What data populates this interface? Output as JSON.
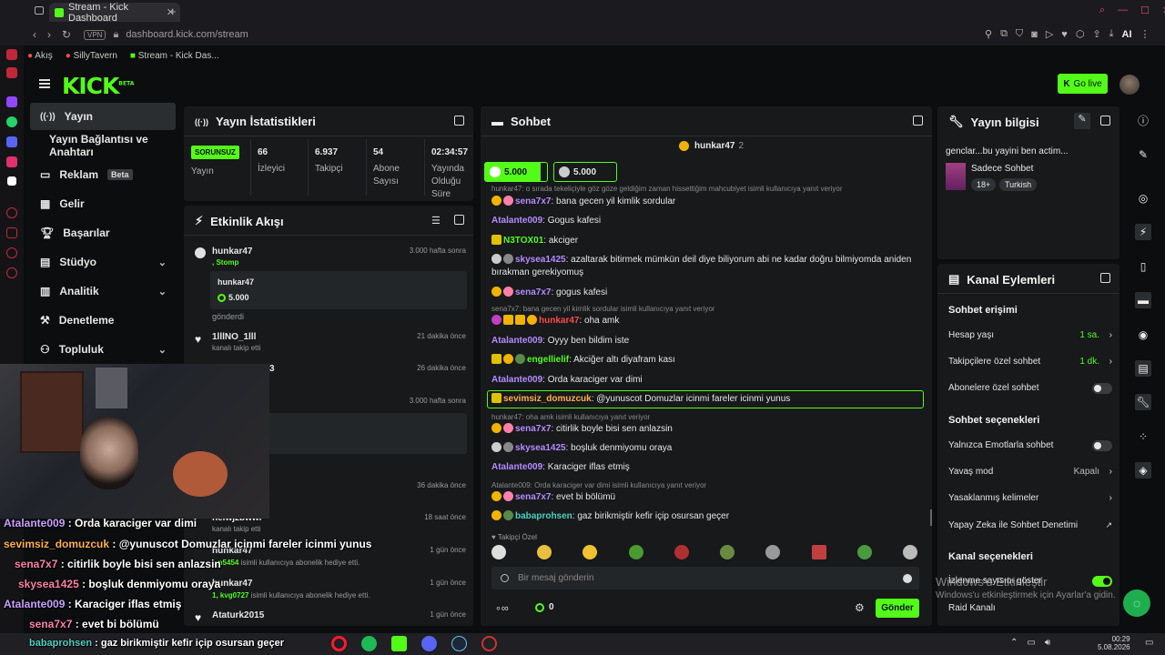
{
  "browser": {
    "tab_title": "Stream - Kick Dashboard",
    "url": "dashboard.kick.com/stream",
    "vpn": "VPN",
    "ai": "AI",
    "bookmarks": [
      "Akış",
      "SillyTavern",
      "Stream - Kick Das..."
    ]
  },
  "header": {
    "logo": "KICK",
    "logo_sup": "BETA",
    "go_live": "Go live"
  },
  "nav": {
    "items": [
      {
        "label": "Yayın"
      },
      {
        "label": "Yayın Bağlantısı ve Anahtarı"
      },
      {
        "label": "Reklam",
        "badge": "Beta"
      },
      {
        "label": "Gelir"
      },
      {
        "label": "Başarılar"
      },
      {
        "label": "Stüdyo"
      },
      {
        "label": "Analitik"
      },
      {
        "label": "Denetleme"
      },
      {
        "label": "Topluluk"
      }
    ]
  },
  "stats": {
    "title": "Yayın İstatistikleri",
    "status": "SORUNSUZ",
    "status_label": "Yayın",
    "viewers": "66",
    "viewers_label": "İzleyici",
    "followers": "6.937",
    "followers_label": "Takipçi",
    "subs": "54",
    "subs_label": "Abone Sayısı",
    "uptime": "02:34:57",
    "uptime_label": "Yayında Olduğu Süre"
  },
  "activity": {
    "title": "Etkinlik Akışı",
    "events": [
      {
        "name": "hunkar47",
        "sub": ", Stomp",
        "time": "3.000 hafta sonra",
        "card_user": "hunkar47",
        "card_amount": "5.000",
        "card_action": "gönderdi"
      },
      {
        "name": "1lllNO_1lll",
        "sub": "kanalı takip etti",
        "time": "21 dakika önce"
      },
      {
        "name": "3",
        "time": "26 dakika önce"
      },
      {
        "time": "3.000 hafta sonra"
      },
      {
        "time": "36 dakika önce"
      },
      {
        "name": "heiwjzbwwi",
        "sub": "kanalı takip etti",
        "time": "18 saat önce"
      },
      {
        "name": "hunkar47",
        "sub_user": "...n5454",
        "sub": " isimli kullanıcıya abonelik hediye etti.",
        "time": "1 gün önce"
      },
      {
        "name": "hunkar47",
        "sub_user": "1, kvg0727",
        "sub": " isimli kullanıcıya abonelik hediye etti.",
        "time": "1 gün önce"
      },
      {
        "name": "Ataturk2015",
        "time": "1 gün önce"
      }
    ]
  },
  "chat": {
    "title": "Sohbet",
    "pinned_user": "hunkar47",
    "pinned_count": "2",
    "gift1": "5.000",
    "gift2": "5.000",
    "messages": [
      {
        "reply": "hunkar47: o sırada tekeliçiyle göz göze geldiğim zaman hissettiğim mahcubiyet isimli kullanıcıya yanıt veriyor"
      },
      {
        "user": "sena7x7",
        "text": ": bana gecen yil kimlik sordular",
        "color": "u-purple"
      },
      {
        "user": "Atalante009",
        "text": ": Gogus kafesi",
        "color": "u-purple"
      },
      {
        "user": "N3TOX01",
        "text": ": akciger",
        "color": "u-green"
      },
      {
        "user": "skysea1425",
        "text": ": azaltarak bitirmek mümkün deil diye biliyorum abi ne kadar doğru bilmiyomda aniden bırakman gerekiyomuş",
        "color": "u-purple"
      },
      {
        "user": "sena7x7",
        "text": ": gogus kafesi",
        "color": "u-purple"
      },
      {
        "reply": "sena7x7: bana gecen yil kimlik sordular isimli kullanıcıya yanıt veriyor"
      },
      {
        "user": "hunkar47",
        "text": ": oha amk",
        "color": "u-red"
      },
      {
        "user": "Atalante009",
        "text": ": Oyyy ben bildim iste",
        "color": "u-purple"
      },
      {
        "user": "engellielif",
        "text": ": Akciğer altı diyafram kası",
        "color": "u-green"
      },
      {
        "user": "Atalante009",
        "text": ": Orda karaciger var dimi",
        "color": "u-purple"
      },
      {
        "user": "sevimsiz_domuzcuk",
        "text": ": @yunuscot Domuzlar icinmi fareler icinmi yunus",
        "color": "u-orange"
      },
      {
        "reply": "hunkar47: oha amk isimli kullanıcıya yanıt veriyor"
      },
      {
        "user": "sena7x7",
        "text": ": citirlik boyle bisi sen anlazsin",
        "color": "u-purple"
      },
      {
        "user": "skysea1425",
        "text": ": boşluk denmiyomu oraya",
        "color": "u-purple"
      },
      {
        "user": "Atalante009",
        "text": ": Karaciger iflas etmiş",
        "color": "u-purple"
      },
      {
        "reply": "Atalante009: Orda karaciger var dimi isimli kullanıcıya yanıt veriyor"
      },
      {
        "user": "sena7x7",
        "text": ": evet bi bölümü",
        "color": "u-purple"
      },
      {
        "user": "babaprohsen",
        "text": ": gaz birikmiştir kefir içip osursan geçer",
        "color": "u-teal"
      }
    ],
    "emote_tab": "Takipçi Özel",
    "input_placeholder": "Bir mesaj gönderin",
    "points": "0",
    "send": "Gönder"
  },
  "stream_info": {
    "title": "Yayın bilgisi",
    "stream_title": "genclar...bu yayini ben actim...",
    "category": "Sadece Sohbet",
    "tags": [
      "18+",
      "Turkish"
    ]
  },
  "channel_actions": {
    "title": "Kanal Eylemleri",
    "chat_access": "Sohbet erişimi",
    "account_age": "Hesap yaşı",
    "account_age_val": "1 sa.",
    "followers_only": "Takipçilere özel sohbet",
    "followers_only_val": "1 dk.",
    "subs_only": "Abonelere özel sohbet",
    "chat_options": "Sohbet seçenekleri",
    "emote_only": "Yalnızca Emotlarla sohbet",
    "slow_mode": "Yavaş mod",
    "slow_mode_val": "Kapalı",
    "banned_words": "Yasaklanmış kelimeler",
    "ai_moderation": "Yapay Zeka ile Sohbet Denetimi",
    "channel_options": "Kanal seçenekleri",
    "show_viewers": "İzlenme sayısını göster",
    "raid": "Raid Kanalı"
  },
  "windows": {
    "activate_1": "Windows'u Etkinleştir",
    "activate_2": "Windows'u etkinleştirmek için Ayarlar'a gidin.",
    "time": "00:29",
    "date": "5.08.2026"
  },
  "overlay": {
    "lines": [
      {
        "user": "Atalante009",
        "text": " : Orda karaciger var dimi",
        "color": "#c8a0ff"
      },
      {
        "user": "sevimsiz_domuzcuk",
        "text": " : @yunuscot Domuzlar icinmi fareler icinmi yunus",
        "color": "#ffb048"
      },
      {
        "user": "sena7x7",
        "text": " : citirlik boyle bisi sen anlazsin",
        "color": "#ff80a8"
      },
      {
        "user": "skysea1425",
        "text": " : boşluk denmiyomu oraya",
        "color": "#ff80a8"
      },
      {
        "user": "Atalante009",
        "text": " : Karaciger iflas etmiş",
        "color": "#c8a0ff"
      },
      {
        "user": "sena7x7",
        "text": " : evet bi bölümü",
        "color": "#ff80a8"
      },
      {
        "user": "babaprohsen",
        "text": " : gaz birikmiştir kefir içip osursan geçer",
        "color": "#4cd0c0"
      }
    ]
  },
  "colors": {
    "brand": "#53fc18",
    "bg": "#0b0d0e",
    "panel": "#17191b"
  }
}
